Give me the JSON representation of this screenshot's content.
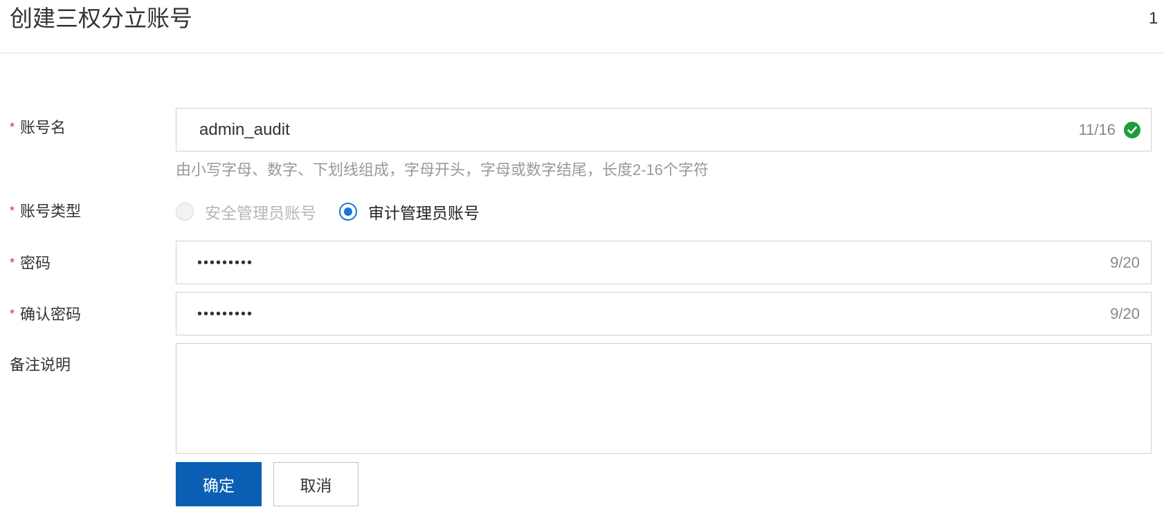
{
  "dialog": {
    "title": "创建三权分立账号",
    "close_glyph": "1"
  },
  "form": {
    "account_name": {
      "required_mark": "*",
      "label": "账号名",
      "value": "admin_audit",
      "counter": "11/16",
      "hint": "由小写字母、数字、下划线组成，字母开头，字母或数字结尾，长度2-16个字符",
      "valid_icon": "check-circle-icon",
      "valid_color": "#1f9d3c"
    },
    "account_type": {
      "required_mark": "*",
      "label": "账号类型",
      "options": [
        {
          "label": "安全管理员账号",
          "state": "disabled"
        },
        {
          "label": "审计管理员账号",
          "state": "checked"
        }
      ]
    },
    "password": {
      "required_mark": "*",
      "label": "密码",
      "value": "•••••••••",
      "counter": "9/20"
    },
    "confirm_password": {
      "required_mark": "*",
      "label": "确认密码",
      "value": "•••••••••",
      "counter": "9/20"
    },
    "remark": {
      "label": "备注说明",
      "value": ""
    }
  },
  "actions": {
    "confirm_label": "确定",
    "cancel_label": "取消",
    "primary_color": "#0a5fb4"
  }
}
